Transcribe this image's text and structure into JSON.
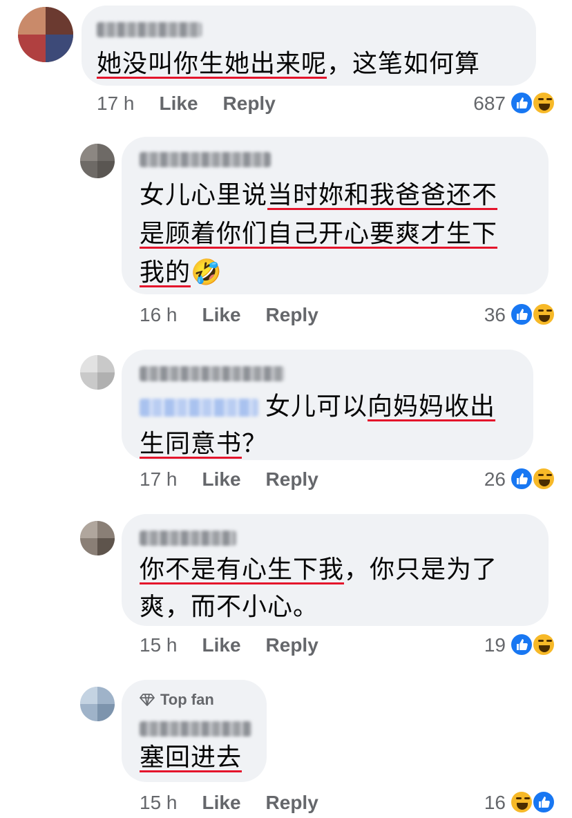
{
  "comments": [
    {
      "text_plain": "，这笔如何算",
      "text_hl": "她没叫你生她出来呢",
      "time": "17 h",
      "like": "Like",
      "reply": "Reply",
      "count": "687"
    },
    {
      "line1_plain": "女儿心里说",
      "line1_hl": "当时妳和我爸爸还不",
      "line2_hl": "是顾着你们自己开心要爽才生下",
      "line3_hl": "我的",
      "line3_emoji": "🤣",
      "time": "16 h",
      "like": "Like",
      "reply": "Reply",
      "count": "36"
    },
    {
      "line1_plain": "女儿可以",
      "line1_hl": "向妈妈收出",
      "line2_hl": "生同意书",
      "line2_plain": "？",
      "time": "17 h",
      "like": "Like",
      "reply": "Reply",
      "count": "26"
    },
    {
      "line1_hl": "你不是有心生下我",
      "line1_plain": "，你只是为了",
      "line2_plain": "爽，而不小心。",
      "time": "15 h",
      "like": "Like",
      "reply": "Reply",
      "count": "19"
    },
    {
      "badge": "Top fan",
      "text_hl": "塞回进去",
      "time": "15 h",
      "like": "Like",
      "reply": "Reply",
      "count": "16"
    }
  ],
  "colors": {
    "underline": "#e4142b",
    "bubble": "#f0f2f5",
    "meta": "#65676b",
    "like": "#1877f2",
    "haha": "#f7b928"
  },
  "icons": {
    "like": "thumbs-up-icon",
    "haha": "laughing-face-icon",
    "topfan": "diamond-icon"
  }
}
